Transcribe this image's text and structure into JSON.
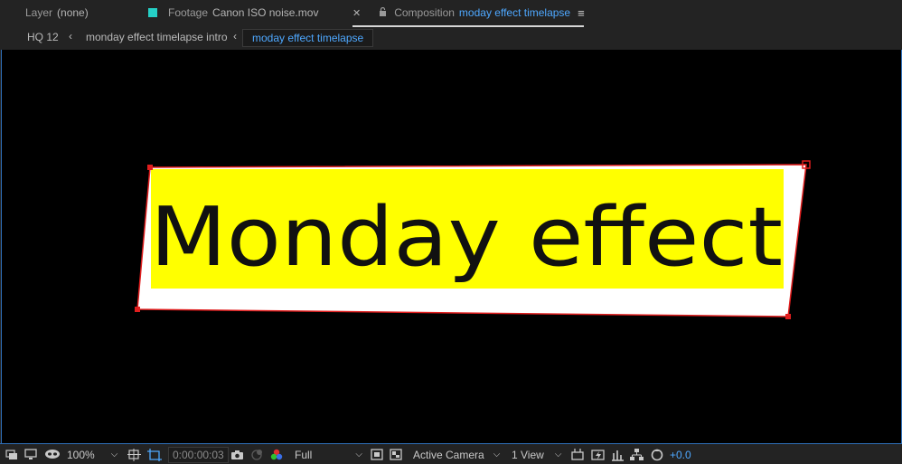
{
  "tabs": [
    {
      "kind": "Layer",
      "name": "(none)"
    },
    {
      "kind": "Footage",
      "name": "Canon ISO noise.mov",
      "swatch": "#25d0c6"
    },
    {
      "kind": "Composition",
      "name": "moday effect timelapse",
      "swatch": "#f08c1a",
      "active": true
    }
  ],
  "breadcrumbs": [
    "HQ 12",
    "monday effect timelapse intro",
    "moday effect timelapse"
  ],
  "composition": {
    "text": "Monday effect",
    "highlight_color": "#ffff00",
    "card_color": "#ffffff",
    "mask_color": "#e01e1e"
  },
  "toolbar": {
    "zoom": "100%",
    "timecode": "0:00:00:03",
    "resolution": "Full",
    "camera": "Active Camera",
    "views": "1 View",
    "exposure": "+0.0"
  },
  "icons": {
    "always_preview": "always-preview-icon",
    "monitor": "monitor-icon",
    "mask": "mask-visibility-icon",
    "grid": "grid-icon",
    "region": "region-of-interest-icon",
    "snapshot": "camera-snapshot-icon",
    "show_snapshot": "show-snapshot-icon",
    "channels": "color-channels-icon",
    "fast_previews": "fast-previews-icon",
    "transparency": "transparency-grid-icon",
    "three_d": "3d-view-icon",
    "timeline": "timeline-icon",
    "flowchart": "flowchart-icon",
    "reset_exposure": "reset-exposure-icon"
  }
}
